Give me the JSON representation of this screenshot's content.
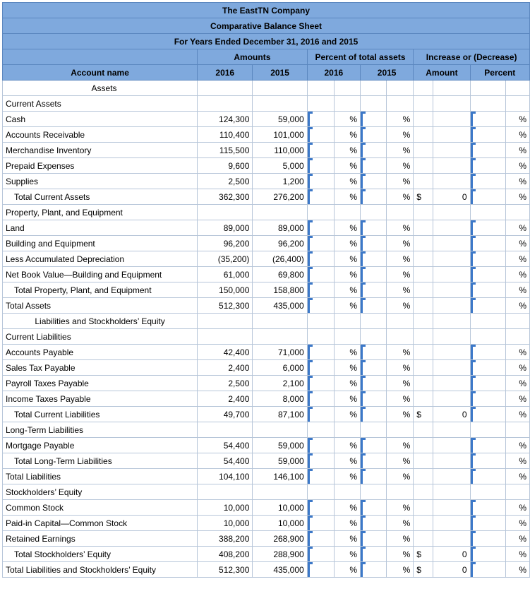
{
  "header": {
    "company": "The EastTN Company",
    "statement": "Comparative Balance Sheet",
    "period": "For Years Ended December 31, 2016 and 2015",
    "group_amounts": "Amounts",
    "group_percent": "Percent of total assets",
    "group_increase": "Increase or (Decrease)",
    "col_account": "Account name",
    "col_amount_2016": "2016",
    "col_amount_2015": "2015",
    "col_pct_2016": "2016",
    "col_pct_2015": "2015",
    "col_inc_amount": "Amount",
    "col_inc_percent": "Percent"
  },
  "symbols": {
    "percent": "%",
    "dollar": "$",
    "zero": "0",
    "empty": ""
  },
  "rows": [
    {
      "name": "Assets",
      "type": "section-center",
      "a2016": "",
      "a2015": "",
      "entry": false
    },
    {
      "name": "Current Assets",
      "type": "section",
      "a2016": "",
      "a2015": "",
      "entry": false
    },
    {
      "name": "Cash",
      "type": "item",
      "a2016": "124,300",
      "a2015": "59,000",
      "entry": true
    },
    {
      "name": "Accounts Receivable",
      "type": "item",
      "a2016": "110,400",
      "a2015": "101,000",
      "entry": true
    },
    {
      "name": "Merchandise Inventory",
      "type": "item",
      "a2016": "115,500",
      "a2015": "110,000",
      "entry": true
    },
    {
      "name": "Prepaid Expenses",
      "type": "item",
      "a2016": "9,600",
      "a2015": "5,000",
      "entry": true
    },
    {
      "name": "Supplies",
      "type": "item",
      "a2016": "2,500",
      "a2015": "1,200",
      "entry": true
    },
    {
      "name": "Total Current Assets",
      "type": "total1",
      "a2016": "362,300",
      "a2015": "276,200",
      "entry": true,
      "inc_dollar": "$",
      "inc_amount": "0"
    },
    {
      "name": "Property, Plant, and Equipment",
      "type": "section",
      "a2016": "",
      "a2015": "",
      "entry": false
    },
    {
      "name": "Land",
      "type": "item",
      "a2016": "89,000",
      "a2015": "89,000",
      "entry": true
    },
    {
      "name": "Building and Equipment",
      "type": "item",
      "a2016": "96,200",
      "a2015": "96,200",
      "entry": true
    },
    {
      "name": "Less Accumulated Depreciation",
      "type": "item",
      "a2016": "(35,200)",
      "a2015": "(26,400)",
      "entry": true
    },
    {
      "name": "Net Book Value—Building and Equipment",
      "type": "item",
      "a2016": "61,000",
      "a2015": "69,800",
      "entry": true
    },
    {
      "name": "Total Property, Plant, and Equipment",
      "type": "total1",
      "a2016": "150,000",
      "a2015": "158,800",
      "entry": true
    },
    {
      "name": "Total Assets",
      "type": "item",
      "a2016": "512,300",
      "a2015": "435,000",
      "entry": true
    },
    {
      "name": "Liabilities and Stockholders’ Equity",
      "type": "section-center2",
      "a2016": "",
      "a2015": "",
      "entry": false
    },
    {
      "name": "Current Liabilities",
      "type": "section",
      "a2016": "",
      "a2015": "",
      "entry": false
    },
    {
      "name": "Accounts Payable",
      "type": "item",
      "a2016": "42,400",
      "a2015": "71,000",
      "entry": true
    },
    {
      "name": "Sales Tax Payable",
      "type": "item",
      "a2016": "2,400",
      "a2015": "6,000",
      "entry": true
    },
    {
      "name": "Payroll Taxes Payable",
      "type": "item",
      "a2016": "2,500",
      "a2015": "2,100",
      "entry": true
    },
    {
      "name": "Income Taxes Payable",
      "type": "item",
      "a2016": "2,400",
      "a2015": "8,000",
      "entry": true
    },
    {
      "name": "Total Current Liabilities",
      "type": "total1",
      "a2016": "49,700",
      "a2015": "87,100",
      "entry": true,
      "inc_dollar": "$",
      "inc_amount": "0"
    },
    {
      "name": "Long-Term Liabilities",
      "type": "section",
      "a2016": "",
      "a2015": "",
      "entry": false
    },
    {
      "name": "Mortgage Payable",
      "type": "item",
      "a2016": "54,400",
      "a2015": "59,000",
      "entry": true
    },
    {
      "name": "Total Long-Term Liabilities",
      "type": "total1",
      "a2016": "54,400",
      "a2015": "59,000",
      "entry": true
    },
    {
      "name": "Total Liabilities",
      "type": "item",
      "a2016": "104,100",
      "a2015": "146,100",
      "entry": true
    },
    {
      "name": "Stockholders’ Equity",
      "type": "section",
      "a2016": "",
      "a2015": "",
      "entry": false
    },
    {
      "name": "Common Stock",
      "type": "item",
      "a2016": "10,000",
      "a2015": "10,000",
      "entry": true
    },
    {
      "name": "Paid-in Capital—Common Stock",
      "type": "item",
      "a2016": "10,000",
      "a2015": "10,000",
      "entry": true
    },
    {
      "name": "Retained Earnings",
      "type": "item",
      "a2016": "388,200",
      "a2015": "268,900",
      "entry": true
    },
    {
      "name": "Total Stockholders’ Equity",
      "type": "total1",
      "a2016": "408,200",
      "a2015": "288,900",
      "entry": true,
      "inc_dollar": "$",
      "inc_amount": "0"
    },
    {
      "name": "Total Liabilities and Stockholders’ Equity",
      "type": "item",
      "a2016": "512,300",
      "a2015": "435,000",
      "entry": true,
      "inc_dollar": "$",
      "inc_amount": "0"
    }
  ]
}
